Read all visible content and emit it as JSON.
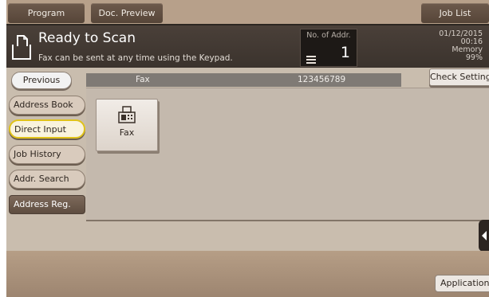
{
  "tabs": {
    "program": "Program",
    "doc_preview": "Doc. Preview",
    "job_list": "Job List"
  },
  "status": {
    "title": "Ready to Scan",
    "message": "Fax can be sent at any time using the Keypad.",
    "addr_label": "No. of Addr.",
    "addr_count": "1",
    "date": "01/12/2015",
    "time": "00:16",
    "memory_label": "Memory",
    "memory_value": "99%"
  },
  "nav": {
    "previous": "Previous",
    "check_setting": "Check Setting",
    "items": [
      {
        "label": "Address Book"
      },
      {
        "label": "Direct Input",
        "selected": true
      },
      {
        "label": "Job History"
      },
      {
        "label": "Addr. Search"
      }
    ],
    "address_reg": "Address Reg."
  },
  "destination": {
    "type": "Fax",
    "number": "123456789"
  },
  "tiles": [
    {
      "label": "Fax",
      "icon": "fax-icon"
    }
  ],
  "bottom": {
    "application": "Application"
  },
  "colors": {
    "selected_outline": "#e0c31a",
    "header_bg": "#3b332d",
    "panel_bg": "#c4b9ad"
  }
}
